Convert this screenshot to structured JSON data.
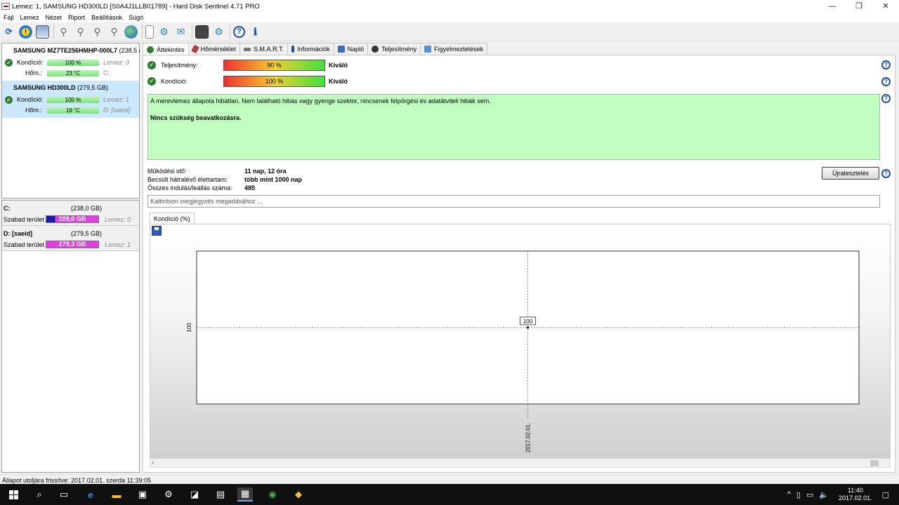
{
  "window": {
    "title": "Lemez: 1, SAMSUNG HD300LD [S0A4J1LLB01789]  -  Hard Disk Sentinel 4.71 PRO",
    "min": "—",
    "max": "❐",
    "close": "✕"
  },
  "menu": [
    "Fájl",
    "Lemez",
    "Nézet",
    "Riport",
    "Beállítások",
    "Súgó"
  ],
  "disks": [
    {
      "name": "SAMSUNG MZ7TE256HMHP-000L7",
      "size": "(238,5 (",
      "cond_label": "Kondíció:",
      "cond_value": "100 %",
      "cond_side": "Lemez: 0",
      "temp_label": "Hőm.:",
      "temp_value": "23 °C",
      "temp_side": "C:"
    },
    {
      "name": "SAMSUNG HD300LD",
      "size": "(279,5 GB)",
      "cond_label": "Kondíció:",
      "cond_value": "100 %",
      "cond_side": "Lemez: 1",
      "temp_label": "Hőm.:",
      "temp_value": "19 °C",
      "temp_side": "D: [saeid]"
    }
  ],
  "volumes": [
    {
      "name": "C:",
      "size": "(238,0 GB)",
      "free_label": "Szabad terület",
      "free_value": "209,0 GB",
      "free_fraction": 0.878,
      "disk": "Lemez: 0"
    },
    {
      "name": "D: [saeid]",
      "size": "(279,5 GB)",
      "free_label": "Szabad terület",
      "free_value": "279,3 GB",
      "free_fraction": 0.999,
      "disk": "Lemez: 1"
    }
  ],
  "tabs": [
    "Áttekintés",
    "Hőmérséklet",
    "S.M.A.R.T.",
    "Információk",
    "Napló",
    "Teljesítmény",
    "Figyelmeztetések"
  ],
  "overview": {
    "perf_label": "Teljesítmény:",
    "perf_value": "90 %",
    "perf_rating": "Kiváló",
    "cond_label": "Kondíció:",
    "cond_value": "100 %",
    "cond_rating": "Kiváló",
    "status_line1": "A merevlemez állapota hibátlan. Nem található hibás vagy gyenge szektor, nincsenek felpörgési és adatátviteli hibák sem.",
    "status_line2": "Nincs szükség beavatkozásra.",
    "uptime_label": "Működési idő:",
    "uptime_value": "11 nap, 12 óra",
    "life_label": "Becsült hátralévő élettartam:",
    "life_value": "több mint 1000 nap",
    "starts_label": "Összes indulás/leállás száma:",
    "starts_value": "485",
    "retest_button": "Újratesztelés",
    "note_placeholder": "Kattintson megjegyzés megadásához ..."
  },
  "chart_tab": "Kondíció  (%)",
  "chart_data": {
    "type": "line",
    "x": [
      "2017.02.01."
    ],
    "series": [
      {
        "values": [
          100
        ]
      }
    ],
    "ytick": "100",
    "data_label": "100"
  },
  "statusbar": "Állapot utoljára frissítve: 2017.02.01. szerda 11:39:05",
  "taskbar": {
    "time": "11:40",
    "date": "2017.02.01."
  }
}
